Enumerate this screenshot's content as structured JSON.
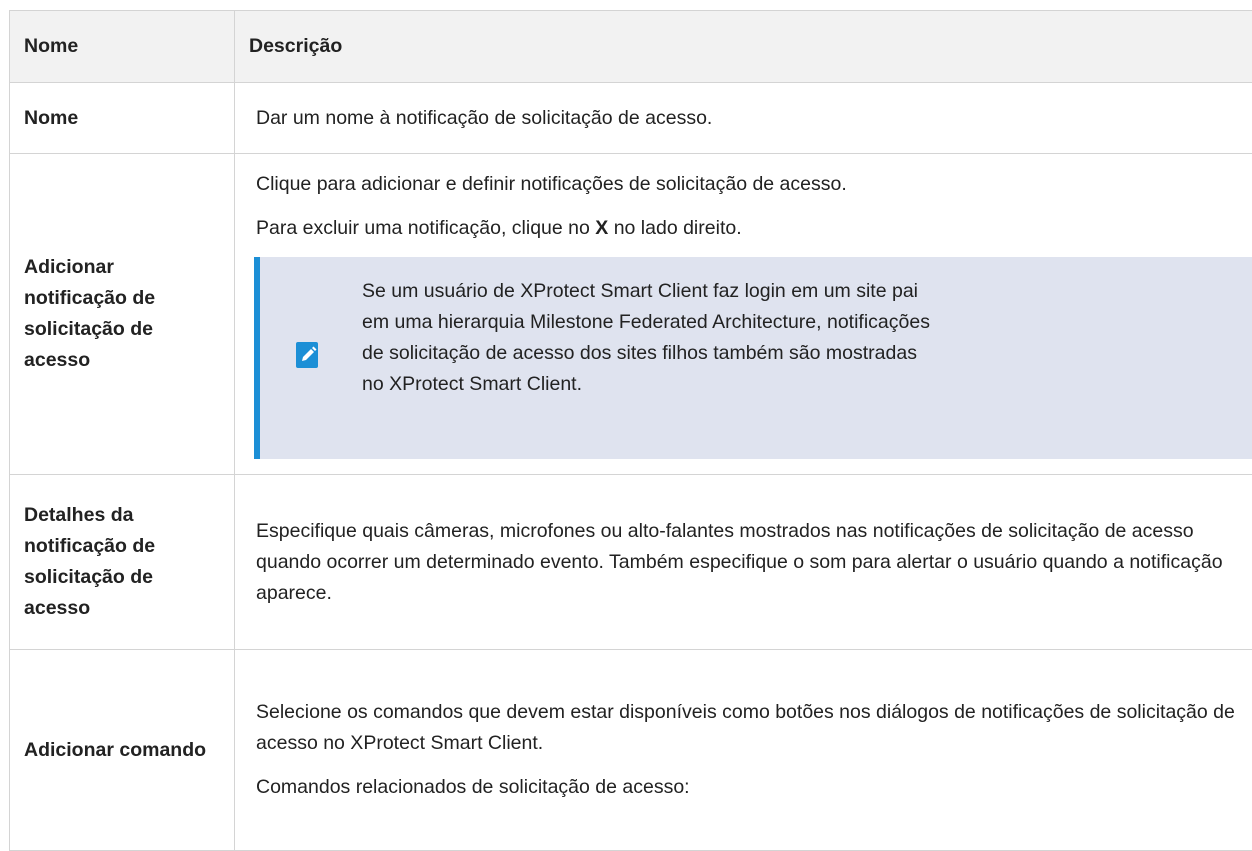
{
  "table": {
    "headers": [
      "Nome",
      "Descrição"
    ],
    "rows": [
      {
        "name": "Nome",
        "desc": "Dar um nome à notificação de solicitação de acesso."
      },
      {
        "name": "Adicionar notificação de solicitação de acesso",
        "desc_p1": "Clique para adicionar e definir notificações de solicitação de acesso.",
        "desc_p2_before": "Para excluir uma notificação, clique no ",
        "desc_p2_bold": "X",
        "desc_p2_after": " no lado direito.",
        "note_icon": "pencil-note-icon",
        "note_text": "Se um usuário de XProtect Smart Client faz login em um site pai em uma hierarquia Milestone Federated Architecture, notificações de solicitação de acesso dos sites filhos também são mostradas no XProtect Smart Client."
      },
      {
        "name": "Detalhes da notificação de solicitação de acesso",
        "desc": "Especifique quais câmeras, microfones ou alto-falantes mostrados nas notificações de solicitação de acesso quando ocorrer um determinado evento. Também especifique o som para alertar o usuário quando a notificação aparece."
      },
      {
        "name": "Adicionar comando",
        "desc_p1": "Selecione os comandos que devem estar disponíveis como botões nos diálogos de notificações de solicitação de acesso no XProtect Smart Client.",
        "desc_p2": "Comandos relacionados de solicitação de acesso:"
      }
    ]
  },
  "colors": {
    "header_bg": "#f2f2f2",
    "note_bg": "#dfe3ef",
    "note_accent": "#1c8fd6",
    "border": "#d4d4d4"
  }
}
